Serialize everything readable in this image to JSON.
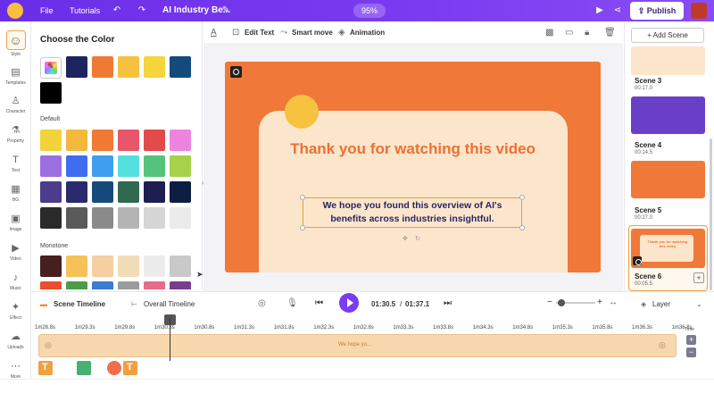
{
  "topbar": {
    "menu_file": "File",
    "menu_tutorials": "Tutorials",
    "project_title": "AI Industry Be...",
    "zoom": "95%",
    "publish": "Publish"
  },
  "leftnav": [
    {
      "label": "Style",
      "icon": "person-icon"
    },
    {
      "label": "Templates",
      "icon": "templates-icon"
    },
    {
      "label": "Character",
      "icon": "character-icon"
    },
    {
      "label": "Property",
      "icon": "property-icon"
    },
    {
      "label": "Text",
      "icon": "text-icon"
    },
    {
      "label": "BG",
      "icon": "background-icon"
    },
    {
      "label": "Image",
      "icon": "image-icon"
    },
    {
      "label": "Video",
      "icon": "video-icon"
    },
    {
      "label": "Music",
      "icon": "music-icon"
    },
    {
      "label": "Effect",
      "icon": "effect-icon"
    },
    {
      "label": "Uploads",
      "icon": "upload-icon"
    },
    {
      "label": "More",
      "icon": "more-icon"
    }
  ],
  "color_panel": {
    "title": "Choose the Color",
    "section_default": "Default",
    "section_monotone": "Monotone",
    "recent": [
      "#1e2460",
      "#ef7a34",
      "#f6c13f",
      "#f4d53a",
      "#144a7c",
      "#000000"
    ],
    "default": [
      "#f3d23a",
      "#f3b93d",
      "#ef7a34",
      "#e8566a",
      "#e34a4a",
      "#ee84e0",
      "#9b6fe0",
      "#3f6cf0",
      "#3f9ef0",
      "#55dede",
      "#54c47c",
      "#a5d24a",
      "#4b3c8c",
      "#2a2a6e",
      "#164a7c",
      "#2f6a50",
      "#1e1e50",
      "#0d1e44",
      "#2a2a2a",
      "#5a5a5a",
      "#8a8a8a",
      "#b4b4b4",
      "#d6d6d6",
      "#ebebeb"
    ],
    "monotone": [
      "#45201c",
      "#f5c25a",
      "#f5cfa2",
      "#f1dcb8",
      "#ececec",
      "#c9c9c9"
    ],
    "monotone_row2": [
      "#e94e2e",
      "#4b9d4a",
      "#3b7bd0",
      "#9b9b9b",
      "#e96a8a",
      "#7a3c8c"
    ]
  },
  "edit_toolbar": {
    "edit_text": "Edit Text",
    "smart_move": "Smart move",
    "animation": "Animation"
  },
  "slide": {
    "title": "Thank you for watching this video",
    "subtitle": "We hope you found this overview of AI's benefits across industries insightful."
  },
  "scenes": {
    "add_scene": "+ Add Scene",
    "items": [
      {
        "name": "Scene 3",
        "duration": "00:17.0",
        "thumb_bg": "#fbe6cc"
      },
      {
        "name": "Scene 4",
        "duration": "00:14.5",
        "thumb_bg": "#6a3fc8"
      },
      {
        "name": "Scene 5",
        "duration": "00:27.0",
        "thumb_bg": "#f07838"
      },
      {
        "name": "Scene 6",
        "duration": "00:05.5",
        "thumb_bg": "#f07838"
      }
    ],
    "active_thumb_text": "Thank you for watching this video"
  },
  "timeline": {
    "scene_timeline": "Scene Timeline",
    "overall_timeline": "Overall Timeline",
    "current_time": "01:30.5",
    "separator": "/",
    "total_time": "01:37.1",
    "layer": "Layer",
    "time_label": "Time",
    "ruler": [
      "1m28.8s",
      "1m29.3s",
      "1m29.8s",
      "1m30.3s",
      "1m30.8s",
      "1m31.3s",
      "1m31.8s",
      "1m32.3s",
      "1m32.8s",
      "1m33.3s",
      "1m33.8s",
      "1m34.3s",
      "1m34.8s",
      "1m35.3s",
      "1m35.8s",
      "1m36.3s",
      "1m36.8s"
    ],
    "track_label": "We hope yo..."
  }
}
